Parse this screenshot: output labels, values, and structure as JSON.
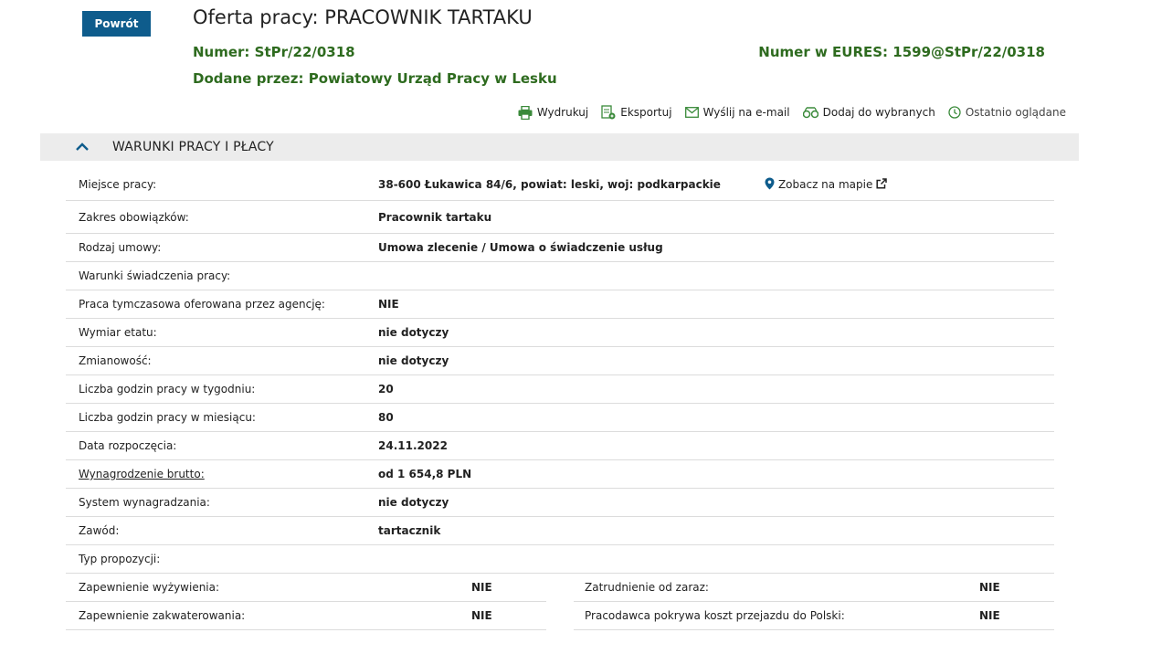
{
  "back_button": "Powrót",
  "title": "Oferta pracy: PRACOWNIK TARTAKU",
  "numer": {
    "label": "Numer:",
    "value": "StPr/22/0318"
  },
  "eures": {
    "label": "Numer w EURES:",
    "value": "1599@StPr/22/0318"
  },
  "added_by": {
    "label": "Dodane przez:",
    "value": "Powiatowy Urząd Pracy w Lesku"
  },
  "actions": {
    "print": "Wydrukuj",
    "export": "Eksportuj",
    "email": "Wyślij na e-mail",
    "favorites": "Dodaj do wybranych",
    "recent": "Ostatnio oglądane"
  },
  "section_title": "WARUNKI PRACY I PŁACY",
  "map_link": "Zobacz na mapie",
  "rows": [
    {
      "key": "Miejsce pracy:",
      "value": "38-600 Łukawica 84/6, powiat: leski, woj: podkarpackie"
    },
    {
      "key": "Zakres obowiązków:",
      "value": "Pracownik tartaku"
    },
    {
      "key": "Rodzaj umowy:",
      "value": "Umowa zlecenie / Umowa o świadczenie usług"
    },
    {
      "key": "Warunki świadczenia pracy:",
      "value": ""
    },
    {
      "key": "Praca tymczasowa oferowana przez agencję:",
      "value": "NIE"
    },
    {
      "key": "Wymiar etatu:",
      "value": "nie dotyczy"
    },
    {
      "key": "Zmianowość:",
      "value": "nie dotyczy"
    },
    {
      "key": "Liczba godzin pracy w tygodniu:",
      "value": "20"
    },
    {
      "key": "Liczba godzin pracy w miesiącu:",
      "value": "80"
    },
    {
      "key": "Data rozpoczęcia:",
      "value": "24.11.2022"
    },
    {
      "key": "Wynagrodzenie brutto:",
      "value": "od 1 654,8 PLN"
    },
    {
      "key": "System wynagradzania:",
      "value": "nie dotyczy"
    },
    {
      "key": "Zawód:",
      "value": "tartacznik"
    },
    {
      "key": "Typ propozycji:",
      "value": ""
    }
  ],
  "bottom": {
    "left": [
      {
        "key": "Zapewnienie wyżywienia:",
        "value": "NIE"
      },
      {
        "key": "Zapewnienie zakwaterowania:",
        "value": "NIE"
      }
    ],
    "right": [
      {
        "key": "Zatrudnienie od zaraz:",
        "value": "NIE"
      },
      {
        "key": "Pracodawca pokrywa koszt przejazdu do Polski:",
        "value": "NIE"
      }
    ]
  },
  "colors": {
    "accent": "#0e5c8c",
    "green": "#2e6b1f",
    "icon_green": "#3a8a3a"
  }
}
